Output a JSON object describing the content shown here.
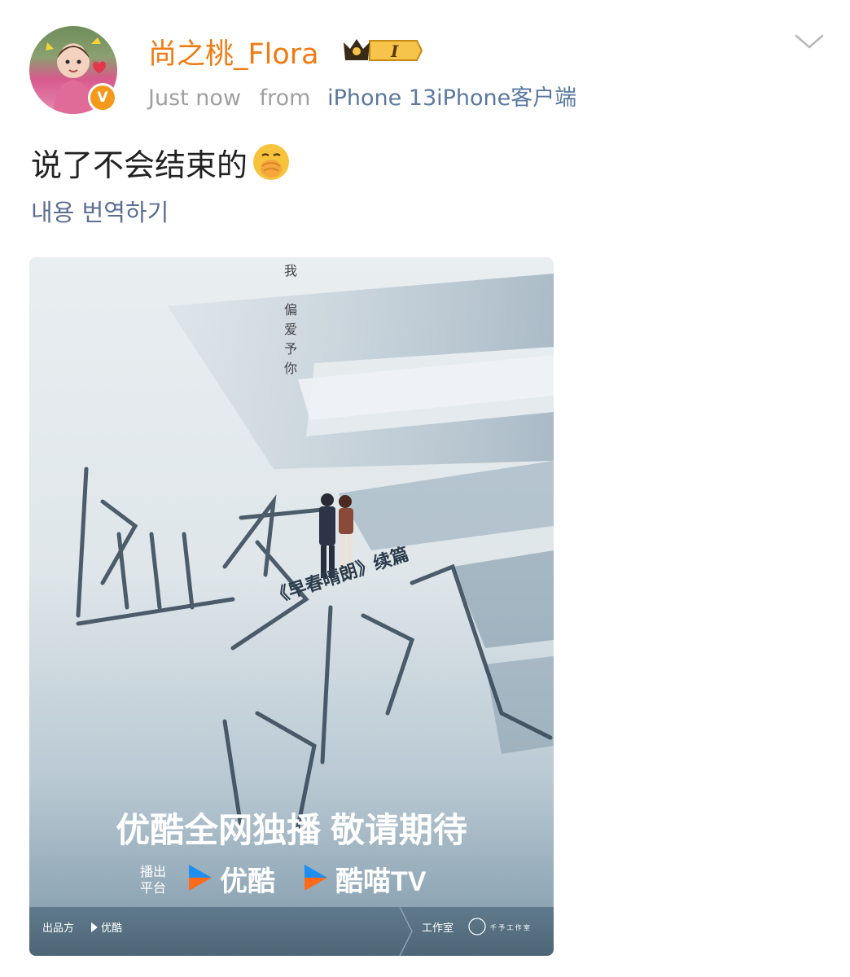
{
  "post": {
    "username": "尚之桃_Flora",
    "level_badge": "I",
    "timestamp": "Just now",
    "source_prefix": "from",
    "source": "iPhone 13iPhone客户端",
    "text": "说了不会结束的",
    "emoji": "hand-over-mouth-emoji",
    "translate_label": "내용 번역하기"
  },
  "poster": {
    "vertical_tagline": [
      "我",
      "偏爱予你"
    ],
    "title_chars": [
      "盛",
      "夏",
      "晴",
      "朗"
    ],
    "subtitle": "《早春晴朗》续篇",
    "headline": "优酷全网独播 敬请期待",
    "platform_label_1": "播出",
    "platform_label_2": "平台",
    "platform_1": "优酷",
    "platform_2": "酷喵TV",
    "footer_left_label": "出品方",
    "footer_left_brand": "优酷",
    "footer_right_label": "工作室",
    "footer_right_studio": "千 予 工 作 室"
  },
  "colors": {
    "username": "#f07b12",
    "meta": "#a0a0a0",
    "source_link": "#5b78a0",
    "translate_link": "#5b6e92",
    "body_text": "#222222"
  }
}
